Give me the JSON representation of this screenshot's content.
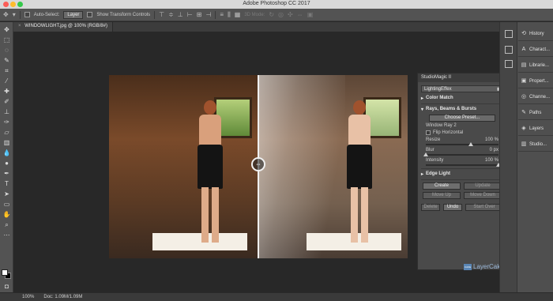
{
  "app": {
    "title": "Adobe Photoshop CC 2017"
  },
  "options_bar": {
    "auto_select_label": "Auto-Select:",
    "auto_select_value": "Layer",
    "transform_label": "Show Transform Controls",
    "mode_3d_label": "3D Mode:"
  },
  "document": {
    "tab_label": "WINDOWLIGHT.jpg @ 100% (RGB/8#)"
  },
  "plugin_panel": {
    "title": "StudioMagic II",
    "preset_dropdown": "LightingEffex",
    "color_match_label": "Color Match",
    "rays_label": "Rays, Beams & Bursts",
    "choose_preset_label": "Choose Preset...",
    "preset_name": "Window Ray 2",
    "flip_label": "Flip Horizontal",
    "resize": {
      "label": "Resize",
      "value": "100 %",
      "level": 0.62
    },
    "blur": {
      "label": "Blur",
      "value": "0 px",
      "level": 0.0
    },
    "intensity": {
      "label": "Intensity",
      "value": "100 %",
      "level": 1.0
    },
    "edge_light_label": "Edge Light",
    "create_label": "Create",
    "update_label": "Update",
    "move_up_label": "Move Up",
    "move_down_label": "Move Down",
    "delete_label": "Delete",
    "undo_label": "Undo",
    "start_over_label": "Start Over",
    "logo_text": "LayerCake",
    "logo_badge": "CAKE"
  },
  "right_panels": [
    {
      "label": "History",
      "icon": "history-icon"
    },
    {
      "label": "Charact...",
      "icon": "character-icon"
    },
    {
      "label": "Librarie...",
      "icon": "libraries-icon"
    },
    {
      "label": "Propert...",
      "icon": "properties-icon"
    },
    {
      "label": "Channe...",
      "icon": "channels-icon"
    },
    {
      "label": "Paths",
      "icon": "paths-icon"
    },
    {
      "label": "Layers",
      "icon": "layers-icon"
    },
    {
      "label": "Studio...",
      "icon": "studio-icon"
    }
  ],
  "status_bar": {
    "zoom": "100%",
    "doc_info": "Doc: 1.09M/1.09M"
  }
}
